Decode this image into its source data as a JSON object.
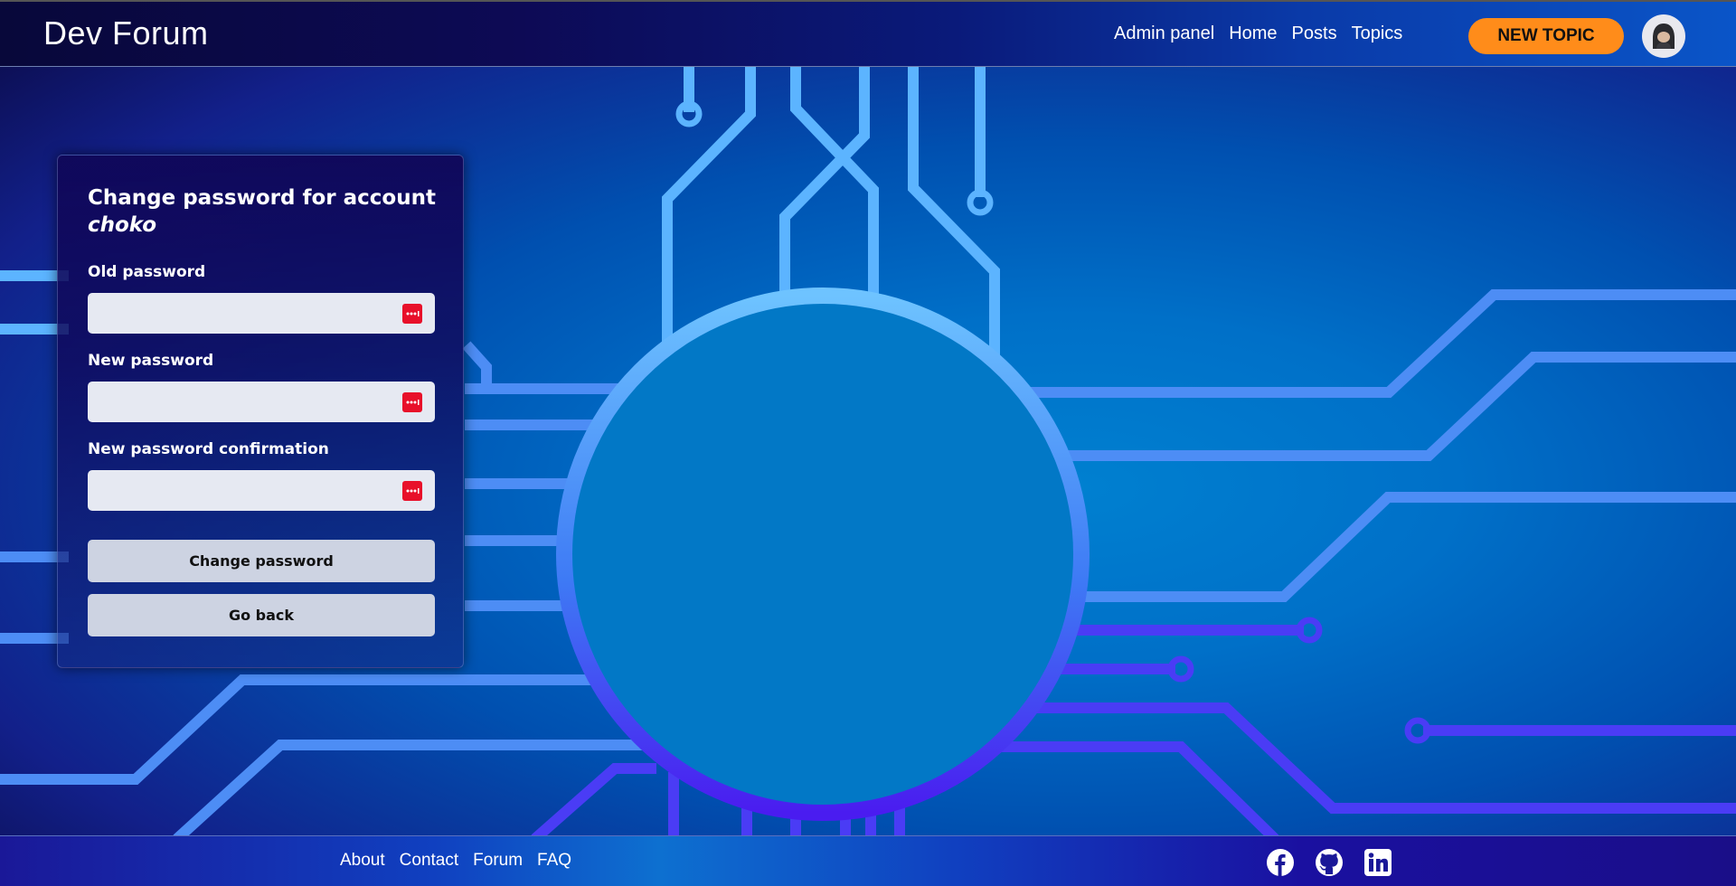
{
  "header": {
    "logo": "Dev Forum",
    "nav": [
      "Admin panel",
      "Home",
      "Posts",
      "Topics"
    ],
    "new_topic_label": "NEW TOPIC"
  },
  "card": {
    "title_prefix": "Change password for account",
    "username": "choko",
    "fields": [
      {
        "label": "Old password",
        "value": ""
      },
      {
        "label": "New password",
        "value": ""
      },
      {
        "label": "New password confirmation",
        "value": ""
      }
    ],
    "submit_label": "Change password",
    "back_label": "Go back"
  },
  "footer": {
    "links": [
      "About",
      "Contact",
      "Forum",
      "FAQ"
    ],
    "social": [
      "facebook-icon",
      "github-icon",
      "linkedin-icon"
    ]
  },
  "colors": {
    "accent": "#ff8c1a",
    "password_manager_icon": "#e8102a"
  }
}
